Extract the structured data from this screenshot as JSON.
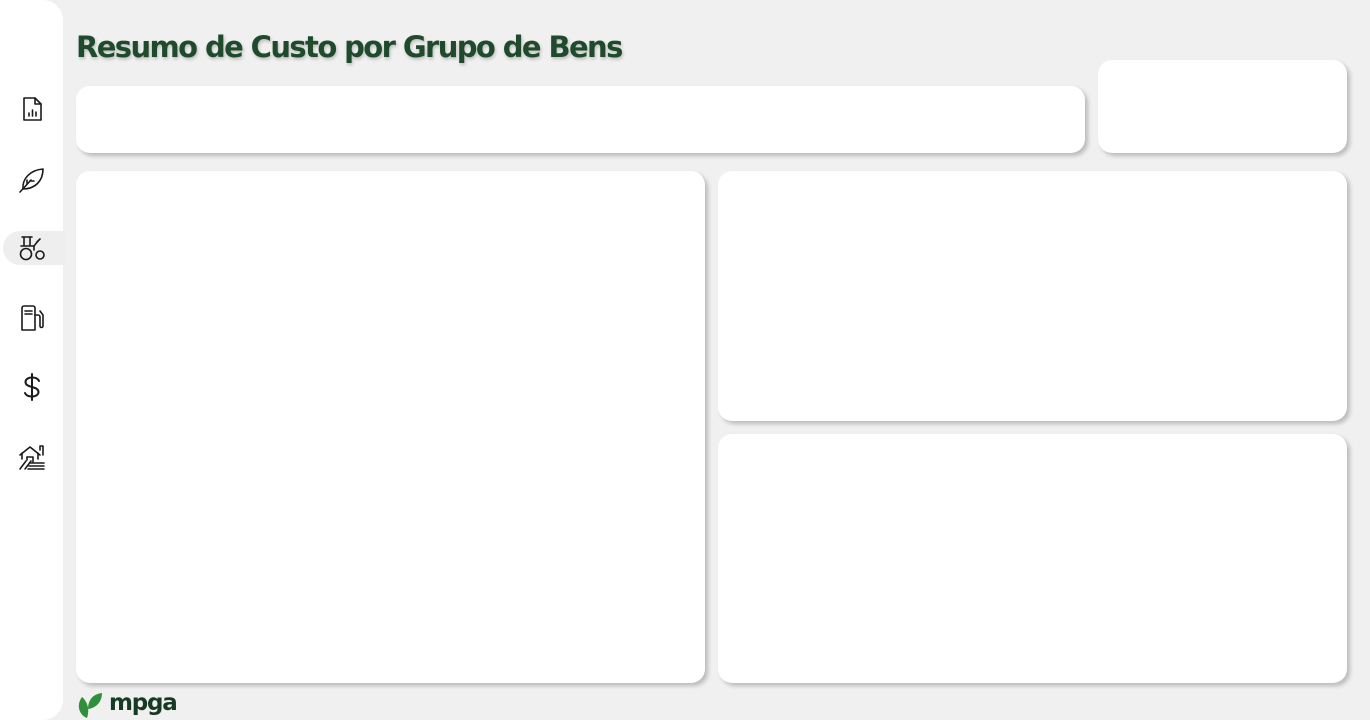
{
  "page": {
    "title": "Resumo de Custo por Grupo de Bens"
  },
  "sidebar": {
    "items": [
      {
        "icon": "report-chart-icon",
        "active": false
      },
      {
        "icon": "leaf-icon",
        "active": false
      },
      {
        "icon": "tractor-icon",
        "active": true
      },
      {
        "icon": "fuel-pump-icon",
        "active": false
      },
      {
        "icon": "dollar-icon",
        "active": false
      },
      {
        "icon": "farm-icon",
        "active": false
      }
    ]
  },
  "footer": {
    "logo_text": "mpga"
  },
  "colors": {
    "title": "#1f4a2c",
    "icon_stroke": "#1a1a1a",
    "logo_green": "#2f8f3a",
    "logo_text": "#173a24",
    "background": "#f0f0f0",
    "card": "#ffffff"
  }
}
